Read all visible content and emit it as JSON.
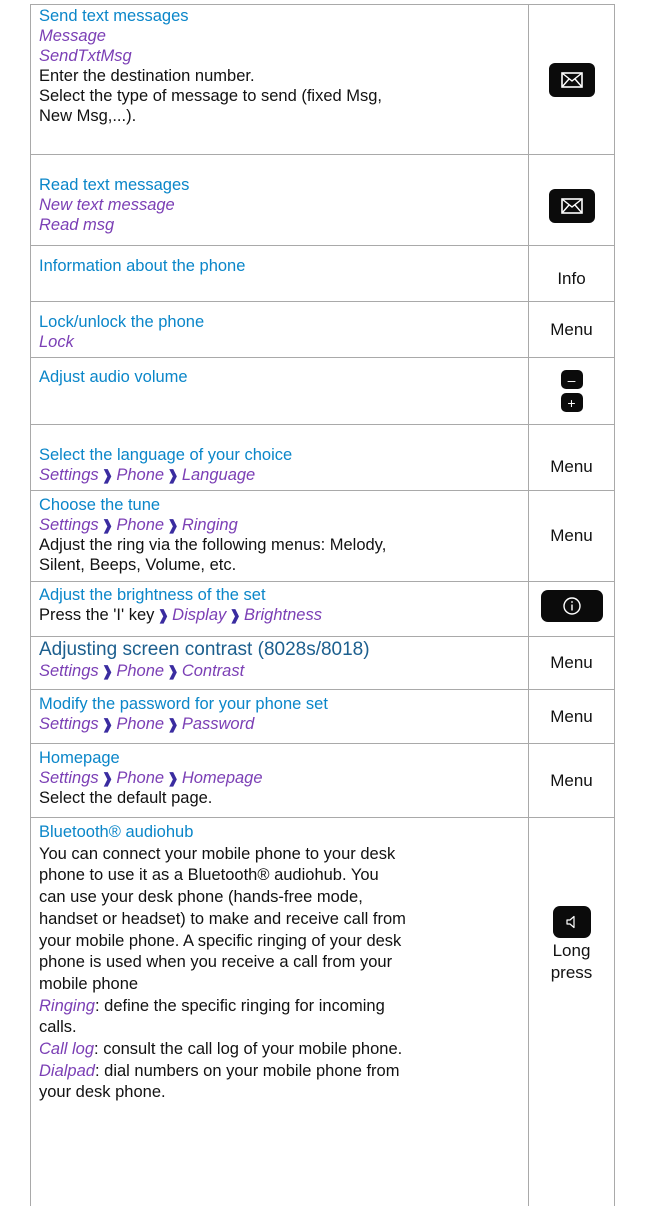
{
  "rows": {
    "send": {
      "title": "Send text messages",
      "p1": "Message",
      "p2": "SendTxtMsg",
      "d1": "Enter the destination number.",
      "d2": "Select the type of message to send (fixed Msg,",
      "d3": "New Msg,...).",
      "icon": "envelope-key-icon"
    },
    "read": {
      "title": "Read text messages",
      "p1": "New text message",
      "p2": "Read msg",
      "icon": "envelope-key-icon"
    },
    "info": {
      "title": "Information about the phone",
      "right": "Info"
    },
    "lock": {
      "title": "Lock/unlock the phone",
      "p1": "Lock",
      "right": "Menu"
    },
    "volume": {
      "title": "Adjust audio volume",
      "minus": "–",
      "plus": "+"
    },
    "language": {
      "title": "Select the language of your choice",
      "path": [
        "Settings",
        "Phone",
        "Language"
      ],
      "right": "Menu"
    },
    "tune": {
      "title": "Choose the tune",
      "path": [
        "Settings",
        "Phone",
        "Ringing"
      ],
      "d1": "Adjust the ring via the following menus: Melody,",
      "d2": "Silent, Beeps, Volume, etc.",
      "right": "Menu"
    },
    "brightness": {
      "title": "Adjust the brightness of the set",
      "prefix": "Press the 'I' key",
      "path": [
        "Display",
        "Brightness"
      ],
      "icon": "info-key-icon"
    },
    "contrast": {
      "title": "Adjusting screen contrast (8028s/8018)",
      "path": [
        "Settings",
        "Phone",
        "Contrast"
      ],
      "right": "Menu"
    },
    "password": {
      "title": "Modify the password for your phone set",
      "path": [
        "Settings",
        "Phone",
        "Password"
      ],
      "right": "Menu"
    },
    "homepage": {
      "title": "Homepage",
      "path": [
        "Settings",
        "Phone",
        "Homepage"
      ],
      "d1": "Select the default page.",
      "right": "Menu"
    },
    "bluetooth": {
      "title": "Bluetooth® audiohub",
      "lines": [
        "You can connect your mobile phone to your desk",
        "phone to use it as a Bluetooth® audiohub. You",
        "can use your desk phone (hands-free mode,",
        "handset or headset) to make and receive call from",
        "your mobile phone. A specific ringing of your desk",
        "phone is used when you receive a call from your",
        "mobile phone"
      ],
      "ringing_term": "Ringing",
      "ringing_rest": ": define the specific ringing for incoming",
      "ringing_cont": "calls.",
      "calllog_term": "Call log",
      "calllog_rest": ": consult the call log of your mobile phone.",
      "dialpad_term": "Dialpad",
      "dialpad_rest": ": dial numbers on your mobile phone from",
      "dialpad_cont": "your desk phone.",
      "right1": "Long",
      "right2": "press",
      "icon": "speaker-key-icon"
    },
    "separator": "❱"
  }
}
